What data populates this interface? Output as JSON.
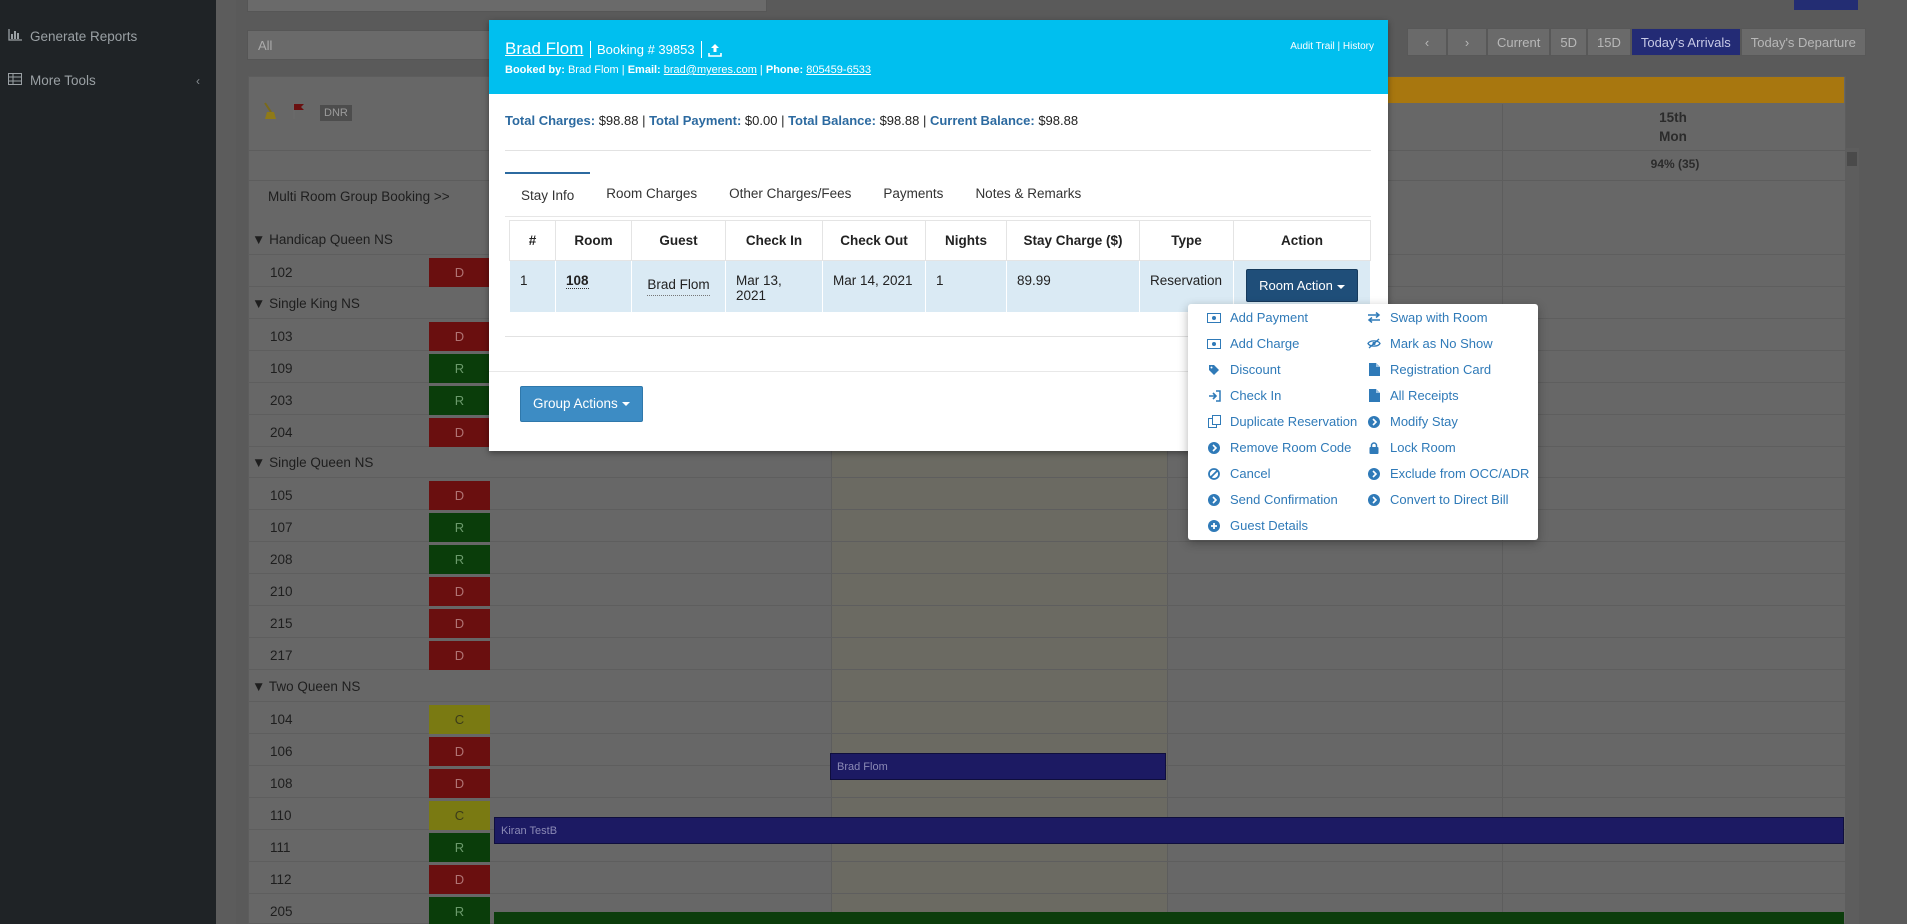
{
  "sidebar": {
    "items": [
      {
        "label": "Generate Reports",
        "icon": "bar-chart-icon"
      },
      {
        "label": "More Tools",
        "icon": "table-icon"
      }
    ]
  },
  "toolbar": {
    "filter_value": "All",
    "nav": [
      "Current",
      "5D",
      "15D",
      "Today's Arrivals",
      "Today's Departure"
    ]
  },
  "grid": {
    "date_day": "15th",
    "date_weekday": "Mon",
    "occupancy": "94% (35)",
    "dnr_label": "DNR",
    "multi_room_label": "Multi Room Group Booking >>",
    "room_types": [
      {
        "label": "Handicap Queen NS"
      },
      {
        "label": "Single King NS"
      },
      {
        "label": "Single Queen NS"
      },
      {
        "label": "Two Queen NS"
      }
    ],
    "rooms": [
      {
        "num": "102",
        "status": "D"
      },
      {
        "num": "103",
        "status": "D"
      },
      {
        "num": "109",
        "status": "R"
      },
      {
        "num": "203",
        "status": "R"
      },
      {
        "num": "204",
        "status": "D"
      },
      {
        "num": "105",
        "status": "D"
      },
      {
        "num": "107",
        "status": "R"
      },
      {
        "num": "208",
        "status": "R"
      },
      {
        "num": "210",
        "status": "D"
      },
      {
        "num": "215",
        "status": "D"
      },
      {
        "num": "217",
        "status": "D"
      },
      {
        "num": "104",
        "status": "C"
      },
      {
        "num": "106",
        "status": "D"
      },
      {
        "num": "108",
        "status": "D"
      },
      {
        "num": "110",
        "status": "C"
      },
      {
        "num": "111",
        "status": "R"
      },
      {
        "num": "112",
        "status": "D"
      },
      {
        "num": "205",
        "status": "R"
      }
    ],
    "bookings": [
      {
        "guest": "Brad Flom"
      },
      {
        "guest": "Kiran TestB"
      }
    ]
  },
  "modal": {
    "guest_name": "Brad Flom",
    "booking_number": "Booking # 39853",
    "booked_by_label": "Booked by:",
    "booked_by": "Brad Flom",
    "email_label": "Email:",
    "email": "brad@myeres.com",
    "phone_label": "Phone:",
    "phone": "805459-6533",
    "audit_trail": "Audit Trail",
    "history": "History",
    "totals": {
      "charges_label": "Total Charges:",
      "charges": "$98.88",
      "payment_label": "Total Payment:",
      "payment": "$0.00",
      "balance_label": "Total Balance:",
      "balance": "$98.88",
      "current_label": "Current Balance:",
      "current": "$98.88"
    },
    "tabs": [
      "Stay Info",
      "Room Charges",
      "Other Charges/Fees",
      "Payments",
      "Notes & Remarks"
    ],
    "table": {
      "headers": [
        "#",
        "Room",
        "Guest",
        "Check In",
        "Check Out",
        "Nights",
        "Stay Charge ($)",
        "Type",
        "Action"
      ],
      "row": {
        "index": "1",
        "room": "108",
        "guest": "Brad Flom",
        "check_in": "Mar 13, 2021",
        "check_out": "Mar 14, 2021",
        "nights": "1",
        "stay_charge": "89.99",
        "type": "Reservation",
        "action_label": "Room Action"
      }
    },
    "group_actions_label": "Group Actions"
  },
  "room_action_menu": {
    "left": [
      {
        "label": "Add Payment",
        "icon": "money-icon"
      },
      {
        "label": "Add Charge",
        "icon": "money-icon"
      },
      {
        "label": "Discount",
        "icon": "tag-icon"
      },
      {
        "label": "Check In",
        "icon": "sign-in-icon"
      },
      {
        "label": "Duplicate Reservation",
        "icon": "copy-icon"
      },
      {
        "label": "Remove Room Code",
        "icon": "circle-arrow-icon"
      },
      {
        "label": "Cancel",
        "icon": "ban-icon"
      },
      {
        "label": "Send Confirmation",
        "icon": "circle-arrow-icon"
      },
      {
        "label": "Guest Details",
        "icon": "plus-circle-icon"
      }
    ],
    "right": [
      {
        "label": "Swap with Room",
        "icon": "exchange-icon"
      },
      {
        "label": "Mark as No Show",
        "icon": "eye-slash-icon"
      },
      {
        "label": "Registration Card",
        "icon": "file-icon"
      },
      {
        "label": "All Receipts",
        "icon": "file-icon"
      },
      {
        "label": "Modify Stay",
        "icon": "circle-arrow-icon"
      },
      {
        "label": "Lock Room",
        "icon": "lock-icon"
      },
      {
        "label": "Exclude from OCC/ADR",
        "icon": "circle-arrow-icon"
      },
      {
        "label": "Convert to Direct Bill",
        "icon": "circle-arrow-icon"
      }
    ]
  },
  "colors": {
    "modal_header": "#00bfef",
    "link_blue": "#2f7ab8",
    "room_action_button": "#1f4e79",
    "group_action_button": "#3d8cc4"
  }
}
